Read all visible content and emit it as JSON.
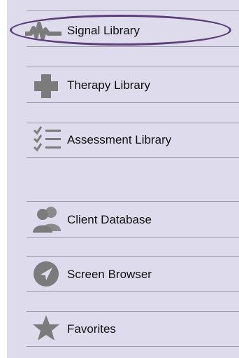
{
  "sidebar": {
    "items": [
      {
        "label": "Signal Library",
        "icon": "waveform-icon",
        "selected": true
      },
      {
        "label": "Therapy Library",
        "icon": "plus-cross-icon"
      },
      {
        "label": "Assessment Library",
        "icon": "checklist-icon"
      },
      {
        "label": "Client Database",
        "icon": "people-icon"
      },
      {
        "label": "Screen Browser",
        "icon": "navigation-arrow-icon"
      },
      {
        "label": "Favorites",
        "icon": "star-icon"
      }
    ]
  },
  "colors": {
    "background": "#dedcec",
    "icon": "#7b7b7b",
    "highlight": "#5b3f78",
    "divider": "#9c9ca6"
  }
}
